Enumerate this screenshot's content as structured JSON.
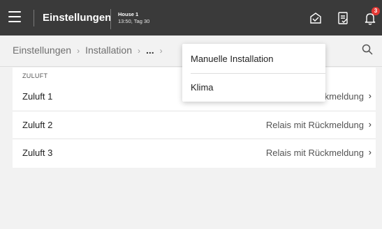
{
  "header": {
    "title": "Einstellungen",
    "house_name": "House 1",
    "house_time": "13:50, Tag 30",
    "notification_count": "3",
    "icons": [
      "menu-icon",
      "house-icon",
      "checklist-icon",
      "bell-icon"
    ]
  },
  "breadcrumb": {
    "items": [
      "Einstellungen",
      "Installation",
      "..."
    ],
    "separator": "›"
  },
  "section": {
    "label": "ZULUFT",
    "rows": [
      {
        "name": "Zuluft 1",
        "value": "Relais mit Rückmeldung"
      },
      {
        "name": "Zuluft 2",
        "value": "Relais mit Rückmeldung"
      },
      {
        "name": "Zuluft 3",
        "value": "Relais mit Rückmeldung"
      }
    ]
  },
  "dropdown": {
    "items": [
      "Manuelle Installation",
      "Klima"
    ]
  }
}
